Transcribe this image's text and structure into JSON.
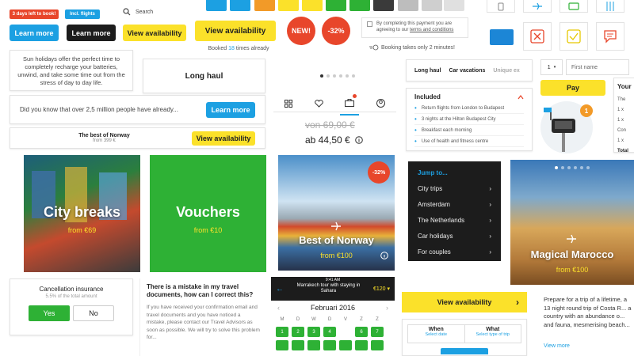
{
  "tags": {
    "days_left": "3 days left to book!",
    "flights": "Incl. flights"
  },
  "buttons": {
    "learn_more": "Learn more",
    "learn_more_dark": "Learn more",
    "view_availability": "View availability",
    "view_availability_big": "View availability",
    "view_availability_small": "View availability",
    "pay": "Pay",
    "view_more": "View more"
  },
  "search": {
    "placeholder": "Search"
  },
  "booked": {
    "prefix": "Booked",
    "count": "18",
    "suffix": "times already"
  },
  "badges": {
    "new": "NEW!",
    "discount": "-32%"
  },
  "payment_note": {
    "text": "By completing this payment you are agreeing to our",
    "link": "terms and conditions"
  },
  "booking_time": "Booking takes only 2 minutes!",
  "colors": {
    "yellow": "#fbe12a",
    "blue": "#1ca0e2",
    "red": "#e8462b",
    "green": "#2eb135",
    "orange": "#f29a28"
  },
  "intro_text": "Sun holidays offer the perfect time to completely recharge your batteries, unwind, and take some time out from the stress of day to day life.",
  "long_haul": "Long haul",
  "did_you_know": "Did you know that over 2,5 million people have already...",
  "norway_card": {
    "title": "The best of Norway",
    "price": "from 399 €"
  },
  "tabs": [
    "Long haul",
    "Car vacations",
    "Unique ex"
  ],
  "price_old": "von 69,00 €",
  "price_new": "ab 44,50 €",
  "included": {
    "title": "Included",
    "items": [
      "Return flights from London to Budapest",
      "3 nights at the Hilton Budapest City",
      "Breakfast each morning",
      "Use of health and fitness centre"
    ]
  },
  "form": {
    "qty": "1",
    "first_name": "First name"
  },
  "notification_count": "1",
  "your_label": "Your",
  "tiles": {
    "city_breaks": {
      "title": "City breaks",
      "price": "from €69"
    },
    "vouchers": {
      "title": "Vouchers",
      "price": "from €10"
    },
    "norway": {
      "title": "Best of Norway",
      "price": "from €100",
      "badge": "-32%"
    },
    "marocco": {
      "title": "Magical Marocco",
      "price": "from €100"
    }
  },
  "jump": {
    "title": "Jump to...",
    "items": [
      "City trips",
      "Amsterdam",
      "The Netherlands",
      "Car holidays",
      "For couples"
    ]
  },
  "insurance": {
    "title": "Cancellation insurance",
    "subtitle": "5.5% of the total amount",
    "yes": "Yes",
    "no": "No"
  },
  "mistake": {
    "title": "There is a mistake in my travel documents, how can I correct this?",
    "body": "If you have received your confirmation email and travel documents and you have noticed a mistake, please contact our Travel Advisors as soon as possible. We will try to solve this problem for..."
  },
  "phone": {
    "time": "9:41 AM",
    "route": "Marrakech tour with staying in Sahara",
    "price": "€120"
  },
  "calendar": {
    "month": "Februari 2016",
    "days": [
      "M",
      "D",
      "W",
      "D",
      "V",
      "Z",
      "Z"
    ],
    "row1": [
      "1",
      "2",
      "3",
      "4",
      "",
      "6",
      "7"
    ]
  },
  "when_what": {
    "when": "When",
    "when_sub": "Select date",
    "what": "What",
    "what_sub": "Select type of trip"
  },
  "marocco_text": "Prepare for a trip of a lifetime, a 13 night round trip of Costa R... a country with an abundance o... and fauna, mesmerising beach...",
  "right_list": [
    "The",
    "1 x",
    "1 x",
    "Con",
    "1 x",
    "Total"
  ]
}
